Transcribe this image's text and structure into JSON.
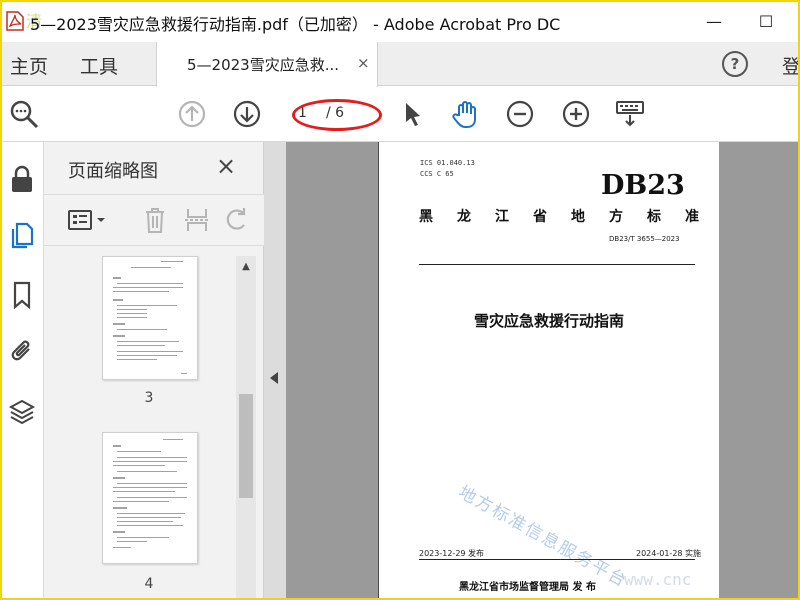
{
  "window": {
    "title": "5—2023雪灾应急救援行动指南.pdf（已加密） - Adobe Acrobat Pro DC",
    "watermark_logo": "清",
    "minimize": "—",
    "maximize": "☐"
  },
  "tabs": {
    "home": "主页",
    "tools": "工具",
    "document": "5—2023雪灾应急救...",
    "document_close": "×",
    "help": "?",
    "login": "登"
  },
  "toolbar": {
    "page_current": "1",
    "page_total": "/ 6"
  },
  "panel": {
    "title": "页面缩略图",
    "close": "×",
    "thumbnails": [
      {
        "label": "3"
      },
      {
        "label": "4"
      }
    ]
  },
  "page": {
    "ics": "ICS 01.040.13",
    "ccs": "CCS C 65",
    "code": "DB23",
    "province_chars": [
      "黑",
      "龙",
      "江",
      "省",
      "地",
      "方",
      "标",
      "准"
    ],
    "standard_number": "DB23/T 3655—2023",
    "title": "雪灾应急救援行动指南",
    "watermark": "地方标准信息服务平台",
    "issue_date": "2023-12-29 发布",
    "implement_date": "2024-01-28 实施",
    "publisher": "黑龙江省市场监督管理局   发 布",
    "corner_url": "www.cnc"
  },
  "colors": {
    "annotation_red": "#e01e1e",
    "hand_blue": "#1a73c9",
    "rail_blue": "#1a73c9",
    "frame_yellow": "#f2d600"
  }
}
